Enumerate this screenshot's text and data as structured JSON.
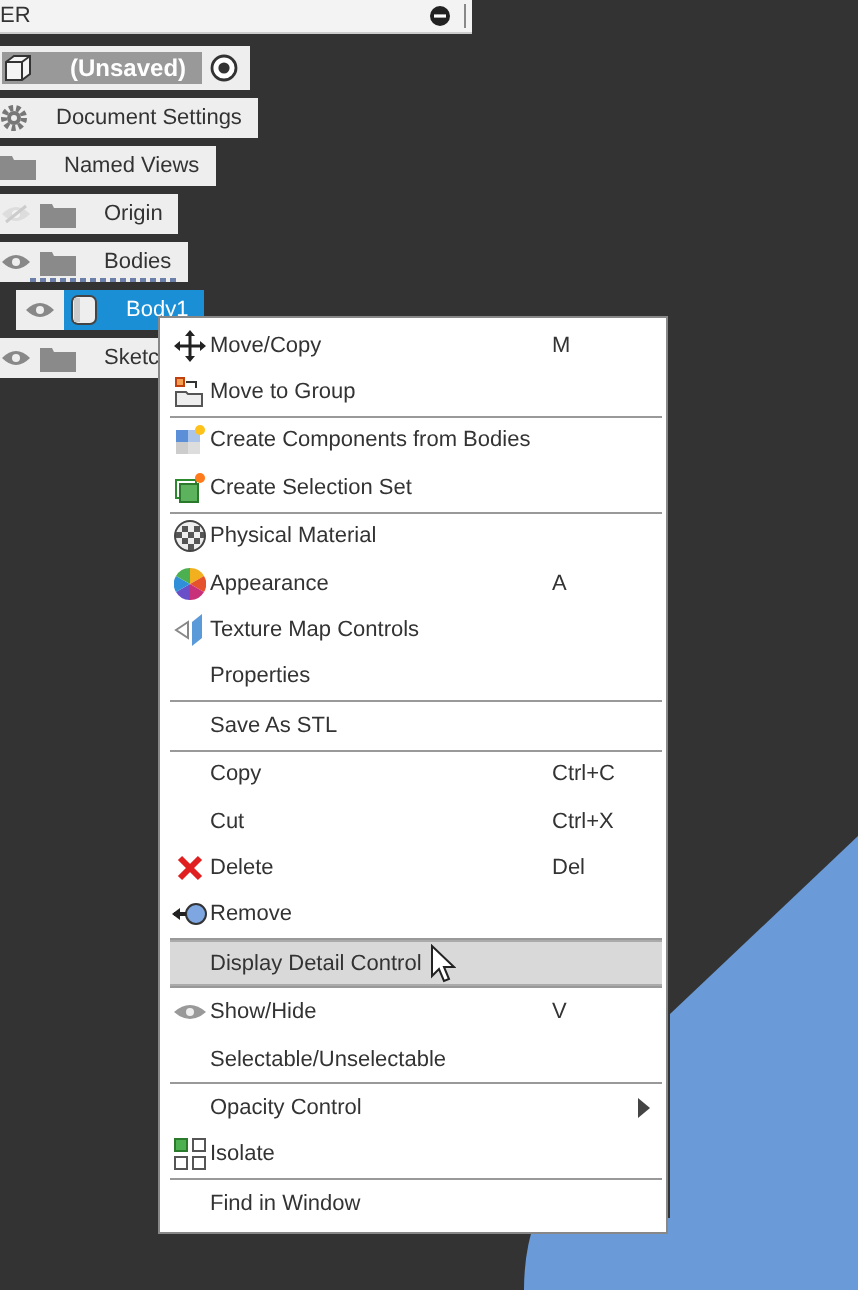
{
  "browser": {
    "title": "ER"
  },
  "tree": {
    "root": {
      "label": "(Unsaved)",
      "active": true
    },
    "items": [
      {
        "label": "Document Settings",
        "kind": "gear"
      },
      {
        "label": "Named Views",
        "kind": "folder"
      },
      {
        "label": "Origin",
        "kind": "folder",
        "visible": false
      },
      {
        "label": "Bodies",
        "kind": "folder",
        "visible": true,
        "children": [
          {
            "label": "Body1",
            "kind": "body",
            "visible": true,
            "selected": true
          }
        ]
      },
      {
        "label": "Sketc",
        "kind": "folder",
        "visible": true
      }
    ]
  },
  "context_menu": {
    "groups": [
      [
        {
          "label": "Move/Copy",
          "shortcut": "M",
          "kind": "move"
        },
        {
          "label": "Move to Group",
          "kind": "group"
        }
      ],
      [
        {
          "label": "Create Components from Bodies",
          "kind": "components"
        },
        {
          "label": "Create Selection Set",
          "kind": "selection"
        }
      ],
      [
        {
          "label": "Physical Material",
          "kind": "material"
        },
        {
          "label": "Appearance",
          "shortcut": "A",
          "kind": "appearance"
        },
        {
          "label": "Texture Map Controls",
          "kind": "texture"
        },
        {
          "label": "Properties"
        }
      ],
      [
        {
          "label": "Save As STL"
        }
      ],
      [
        {
          "label": "Copy",
          "shortcut": "Ctrl+C"
        },
        {
          "label": "Cut",
          "shortcut": "Ctrl+X"
        },
        {
          "label": "Delete",
          "shortcut": "Del",
          "kind": "delete"
        },
        {
          "label": "Remove",
          "kind": "remove"
        }
      ],
      [
        {
          "label": "Display Detail Control",
          "highlighted": true
        }
      ],
      [
        {
          "label": "Show/Hide",
          "shortcut": "V",
          "kind": "visibility"
        },
        {
          "label": "Selectable/Unselectable"
        }
      ],
      [
        {
          "label": "Opacity Control",
          "submenu": true
        },
        {
          "label": "Isolate",
          "kind": "isolate"
        }
      ],
      [
        {
          "label": "Find in Window"
        }
      ]
    ]
  }
}
